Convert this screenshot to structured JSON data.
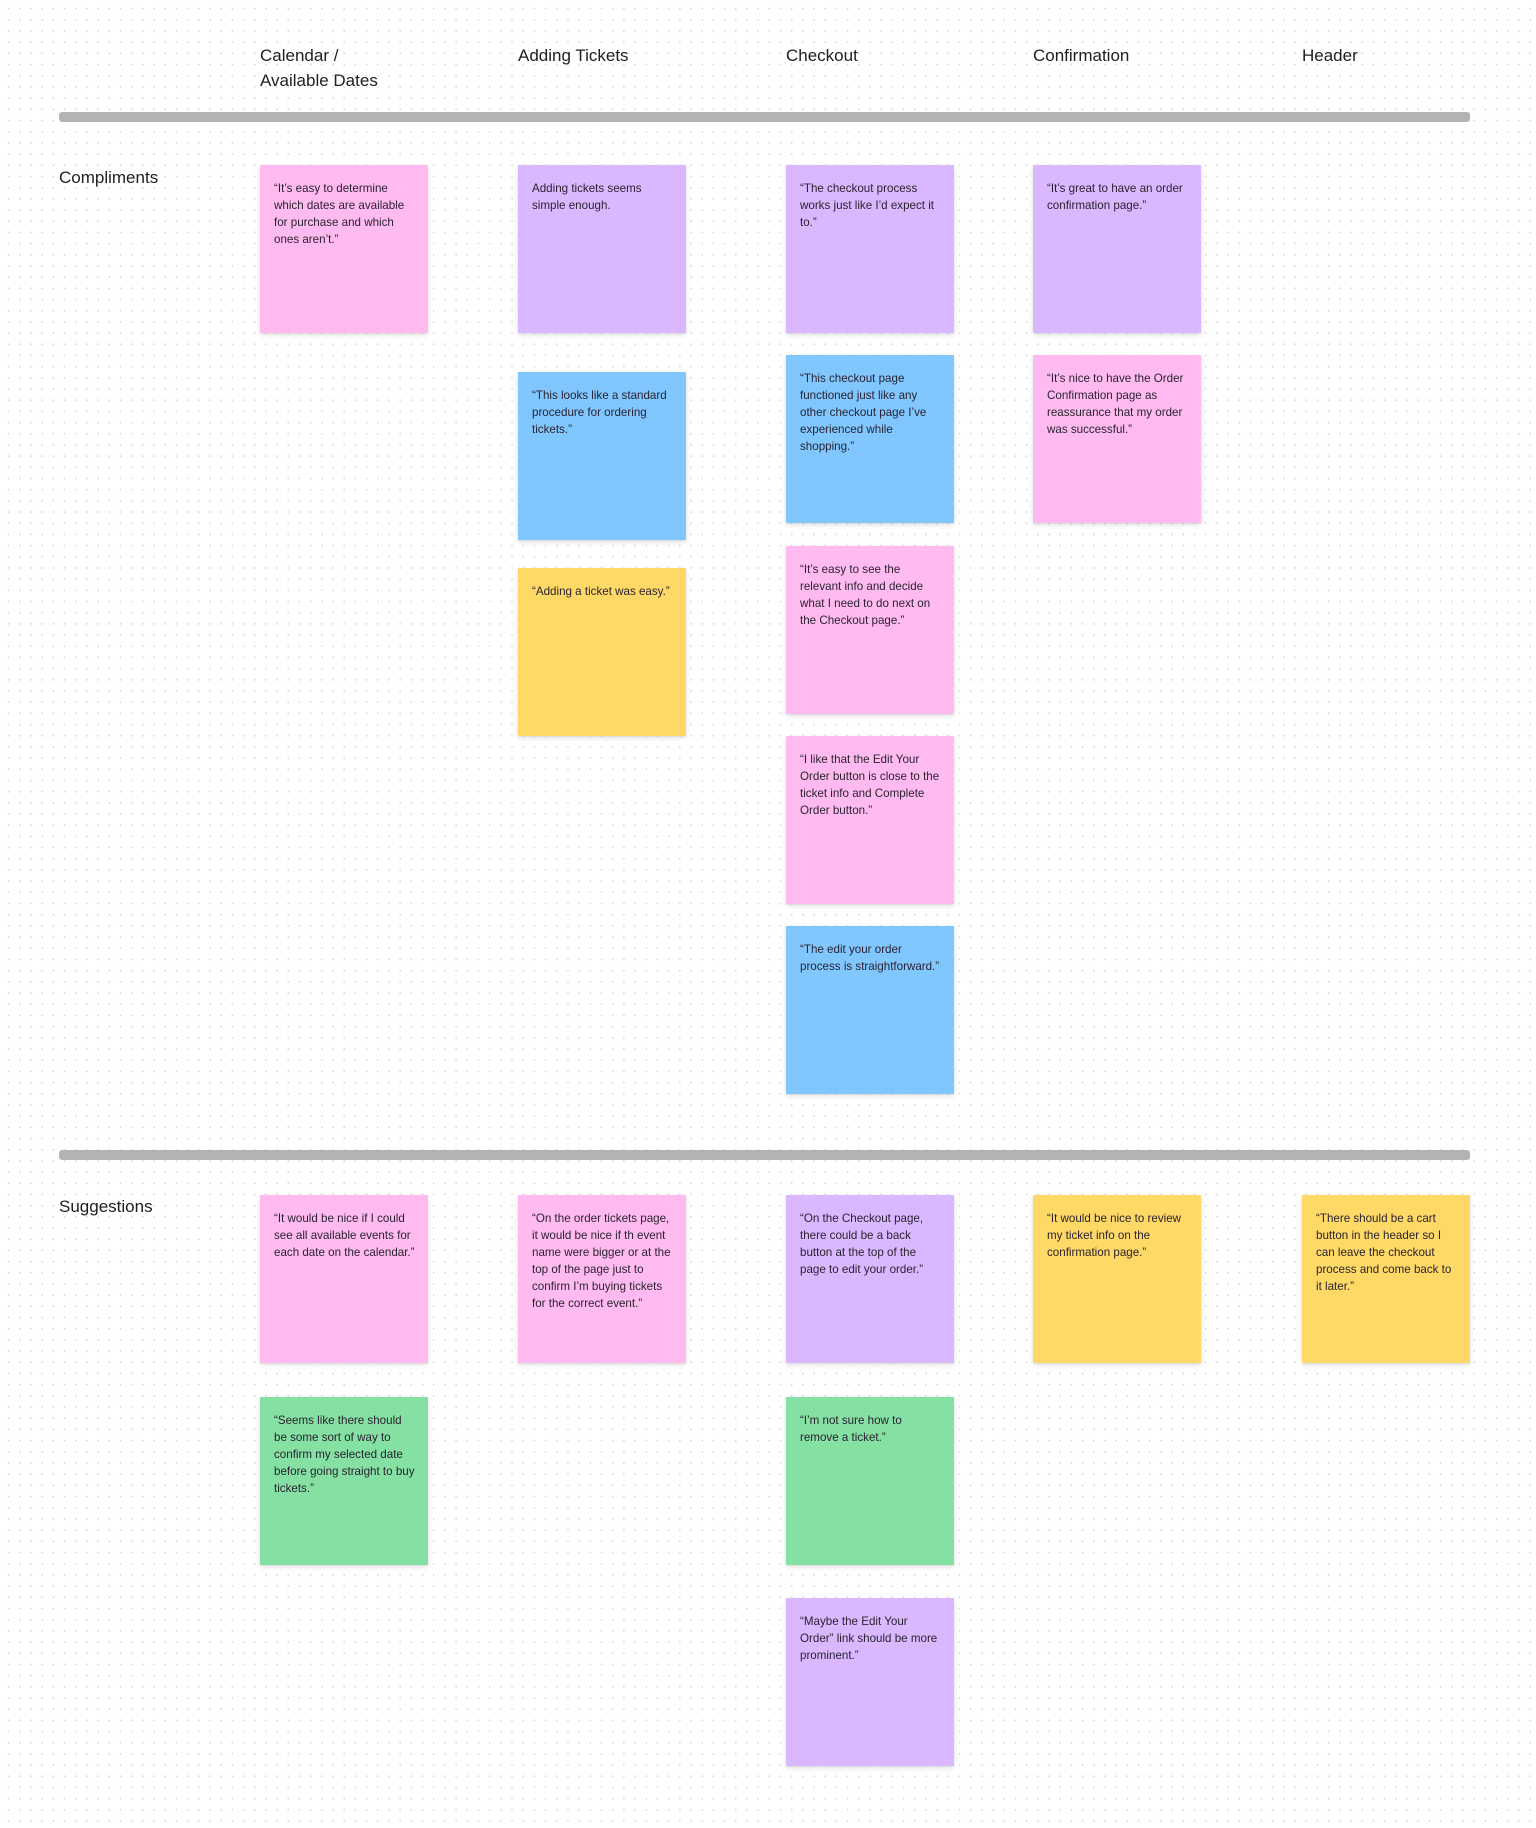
{
  "board": {
    "columns": [
      {
        "id": "calendar",
        "title": "Calendar /\nAvailable Dates"
      },
      {
        "id": "adding-tickets",
        "title": "Adding Tickets"
      },
      {
        "id": "checkout",
        "title": "Checkout"
      },
      {
        "id": "confirmation",
        "title": "Confirmation"
      },
      {
        "id": "header",
        "title": "Header"
      }
    ],
    "rows": [
      {
        "id": "compliments",
        "label": "Compliments"
      },
      {
        "id": "suggestions",
        "label": "Suggestions"
      }
    ],
    "colors": {
      "pink": "#FFBBF0",
      "purple": "#D9B8FF",
      "blue": "#80C7FF",
      "yellow": "#FFD966",
      "green": "#85E0A3",
      "divider": "#B3B3B3"
    },
    "stickies": [
      {
        "row": "compliments",
        "column": "calendar",
        "color": "pink",
        "text": "“It’s easy to determine which dates are available for purchase and which ones aren’t.”"
      },
      {
        "row": "compliments",
        "column": "adding-tickets",
        "color": "purple",
        "text": "Adding tickets seems simple enough."
      },
      {
        "row": "compliments",
        "column": "adding-tickets",
        "color": "blue",
        "text": "“This looks like a standard procedure for ordering tickets.”"
      },
      {
        "row": "compliments",
        "column": "adding-tickets",
        "color": "yellow",
        "text": "“Adding a ticket was easy.”"
      },
      {
        "row": "compliments",
        "column": "checkout",
        "color": "purple",
        "text": "“The checkout process works just like I’d expect it to.”"
      },
      {
        "row": "compliments",
        "column": "checkout",
        "color": "blue",
        "text": "“This checkout page functioned just like any other checkout page I’ve experienced while shopping.”"
      },
      {
        "row": "compliments",
        "column": "checkout",
        "color": "pink",
        "text": "“It’s easy to see the relevant info and decide what I need to do next on the Checkout page.”"
      },
      {
        "row": "compliments",
        "column": "checkout",
        "color": "pink",
        "text": "“I like that the Edit Your Order button is close to the ticket info and Complete Order button.”"
      },
      {
        "row": "compliments",
        "column": "checkout",
        "color": "blue",
        "text": "“The edit your order process is straightforward.”"
      },
      {
        "row": "compliments",
        "column": "confirmation",
        "color": "purple",
        "text": "“It’s great to have an order confirmation page.”"
      },
      {
        "row": "compliments",
        "column": "confirmation",
        "color": "pink",
        "text": "“It’s nice to have the Order Confirmation page as reassurance that my order was successful.”"
      },
      {
        "row": "suggestions",
        "column": "calendar",
        "color": "pink",
        "text": "“It would be nice if I could see all available events for each date on the calendar.”"
      },
      {
        "row": "suggestions",
        "column": "calendar",
        "color": "green",
        "text": "“Seems like there should be some sort of way to confirm my selected date before going straight to buy tickets.”"
      },
      {
        "row": "suggestions",
        "column": "adding-tickets",
        "color": "pink",
        "text": "“On the order tickets page, it would be nice if th event name were bigger or at the top of the page just to confirm I’m buying tickets for the correct event.”"
      },
      {
        "row": "suggestions",
        "column": "checkout",
        "color": "purple",
        "text": "“On the Checkout page, there could be a back button at the top of the page to edit your order.”"
      },
      {
        "row": "suggestions",
        "column": "checkout",
        "color": "green",
        "text": "“I’m not sure how to remove a ticket.”"
      },
      {
        "row": "suggestions",
        "column": "checkout",
        "color": "purple",
        "text": "“Maybe the Edit Your Order” link should be more prominent.”"
      },
      {
        "row": "suggestions",
        "column": "confirmation",
        "color": "yellow",
        "text": "“It would be nice to review my ticket info on the confirmation page.”"
      },
      {
        "row": "suggestions",
        "column": "header",
        "color": "yellow",
        "text": "“There should be a cart button in the header so I can leave the checkout process and come back to it later.”"
      }
    ]
  }
}
